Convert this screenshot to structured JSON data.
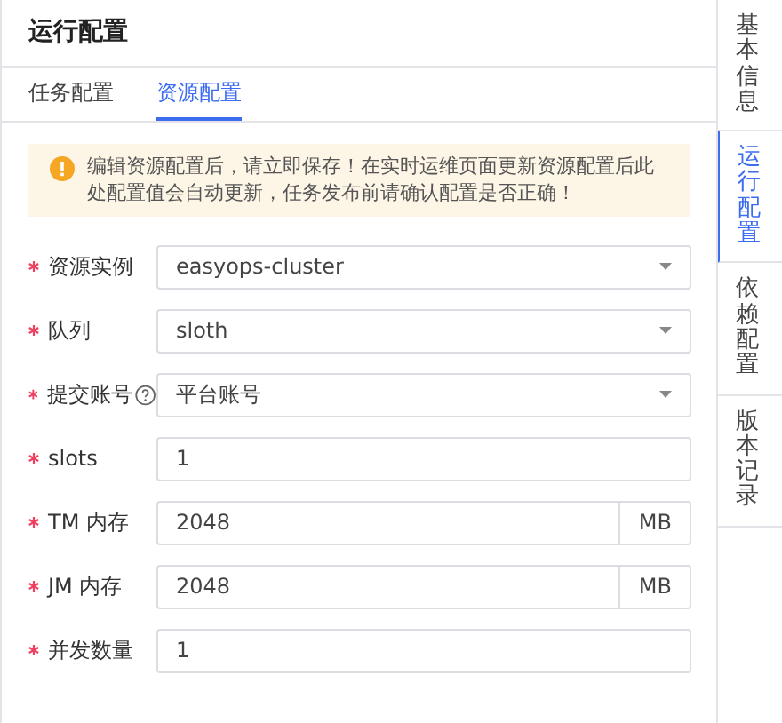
{
  "panel": {
    "title": "运行配置"
  },
  "tabs": [
    {
      "label": "任务配置",
      "selected": false
    },
    {
      "label": "资源配置",
      "selected": true
    }
  ],
  "alert": {
    "text": "编辑资源配置后，请立即保存！在实时运维页面更新资源配置后此处配置值会自动更新，任务发布前请确认配置是否正确！"
  },
  "fields": [
    {
      "kind": "select",
      "label": "资源实例",
      "required": true,
      "value": "easyops-cluster"
    },
    {
      "kind": "select",
      "label": "队列",
      "required": true,
      "value": "sloth"
    },
    {
      "kind": "select",
      "label": "提交账号",
      "required": true,
      "help": true,
      "value": "平台账号"
    },
    {
      "kind": "input",
      "label": "slots",
      "required": true,
      "value": "1"
    },
    {
      "kind": "unit",
      "label": "TM 内存",
      "required": true,
      "value": "2048",
      "unit": "MB"
    },
    {
      "kind": "unit",
      "label": "JM 内存",
      "required": true,
      "value": "2048",
      "unit": "MB"
    },
    {
      "kind": "input",
      "label": "并发数量",
      "required": true,
      "value": "1"
    }
  ],
  "side_tabs": [
    {
      "label": "基本信息",
      "selected": false
    },
    {
      "label": "运行配置",
      "selected": true
    },
    {
      "label": "依赖配置",
      "selected": false
    },
    {
      "label": "版本记录",
      "selected": false
    }
  ]
}
